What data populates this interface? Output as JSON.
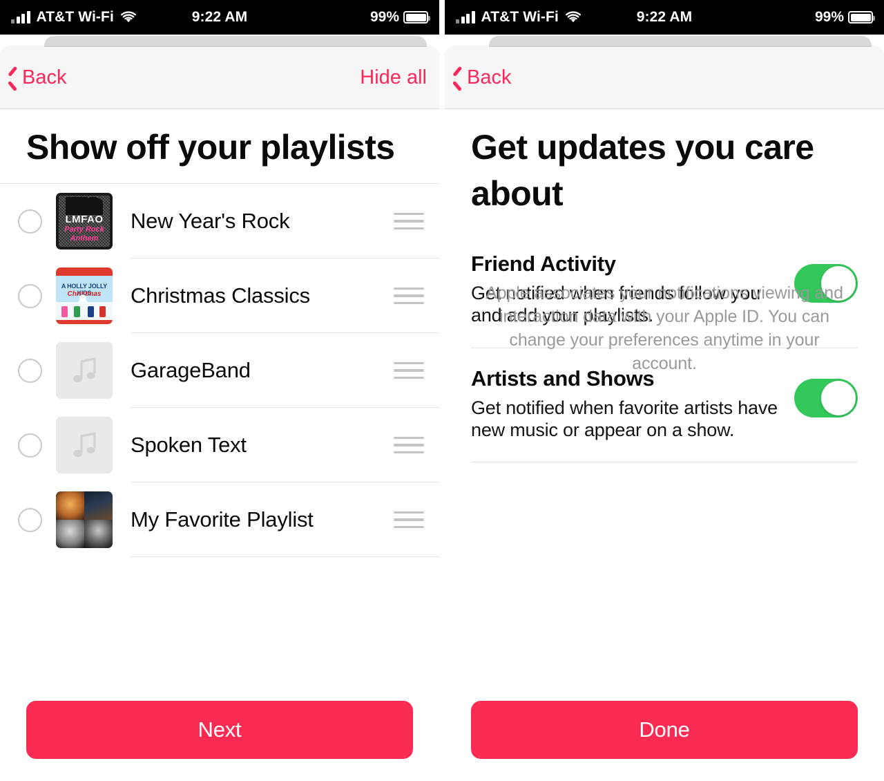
{
  "colors": {
    "accent_pink": "#fa2b53",
    "toggle_green": "#34c759",
    "statusbar_bg": "#000000",
    "navbar_bg": "#f6f6f7"
  },
  "status_bar": {
    "carrier": "AT&T Wi-Fi",
    "signal_icon": "signal-bars-icon",
    "wifi_icon": "wifi-icon",
    "time": "9:22 AM",
    "battery_percent": "99%",
    "battery_icon": "battery-icon"
  },
  "left_screen": {
    "nav": {
      "back_label": "Back",
      "back_icon": "chevron-left-icon",
      "action_label": "Hide all"
    },
    "headline": "Show off your playlists",
    "playlists": [
      {
        "title": "New Year's Rock",
        "artwork": "lmfao-party-rock-anthem",
        "selected": false,
        "art_text": {
          "logo": "LMFAO",
          "line1": "Party Rock",
          "line2": "Anthem"
        }
      },
      {
        "title": "Christmas Classics",
        "artwork": "holly-jolly-kids-christmas",
        "selected": false,
        "art_text": {
          "line1": "A HOLLY JOLLY KIDS",
          "line2": "Christmas"
        }
      },
      {
        "title": "GarageBand",
        "artwork": "music-note-placeholder",
        "selected": false
      },
      {
        "title": "Spoken Text",
        "artwork": "music-note-placeholder",
        "selected": false
      },
      {
        "title": "My Favorite Playlist",
        "artwork": "four-photo-collage",
        "selected": false
      }
    ],
    "drag_handle_icon": "drag-handle-icon",
    "cta_label": "Next"
  },
  "right_screen": {
    "nav": {
      "back_label": "Back",
      "back_icon": "chevron-left-icon"
    },
    "headline": "Get updates you care about",
    "settings": [
      {
        "title": "Friend Activity",
        "description": "Get notified when friends follow you and add your playlists.",
        "toggle_on": true
      },
      {
        "title": "Artists and Shows",
        "description": "Get notified when favorite artists have new music or appear on a show.",
        "toggle_on": true
      }
    ],
    "disclaimer": "Apple associates your notifications viewing and interaction data with your Apple ID. You can change your preferences anytime in your account.",
    "cta_label": "Done"
  }
}
